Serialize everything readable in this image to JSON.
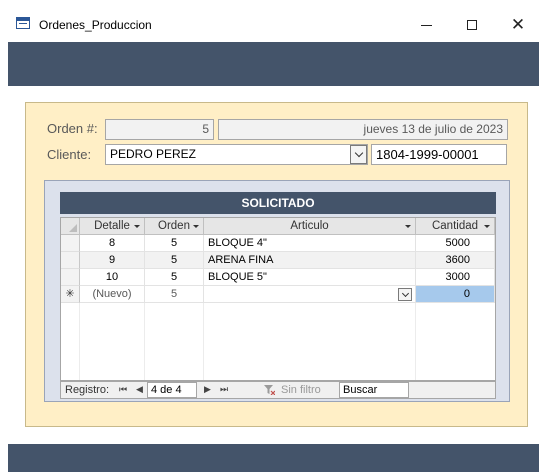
{
  "window": {
    "title": "Ordenes_Produccion",
    "icon": "access-form-icon",
    "buttons": {
      "minimize": "minimize-icon",
      "maximize": "maximize-icon",
      "close": "✕"
    }
  },
  "colors": {
    "header_band": "#44546a",
    "form_background": "#ffefc6",
    "new_row_highlight": "#a6c9ec"
  },
  "form": {
    "orden_label": "Orden #:",
    "orden_value": "5",
    "fecha_value": "jueves 13 de julio de 2023",
    "cliente_label": "Cliente:",
    "cliente_value": "PEDRO PEREZ",
    "cliente_id": "1804-1999-00001"
  },
  "subform": {
    "title": "SOLICITADO",
    "columns": [
      "Detalle",
      "Orden",
      "Articulo",
      "Cantidad"
    ],
    "rows": [
      {
        "detalle": "8",
        "orden": "5",
        "articulo": "BLOQUE 4\"",
        "cantidad": "5000"
      },
      {
        "detalle": "9",
        "orden": "5",
        "articulo": "ARENA FINA",
        "cantidad": "3600"
      },
      {
        "detalle": "10",
        "orden": "5",
        "articulo": "BLOQUE 5\"",
        "cantidad": "3000"
      }
    ],
    "new_row": {
      "marker": "✳",
      "detalle": "(Nuevo)",
      "orden": "5",
      "articulo": "",
      "cantidad": "0"
    }
  },
  "navigation": {
    "record_label": "Registro:",
    "first": "⏮",
    "prev": "◀",
    "position": "4 de 4",
    "next": "▶",
    "last": "⏭",
    "filter_label": "Sin filtro",
    "search_label": "Buscar"
  }
}
